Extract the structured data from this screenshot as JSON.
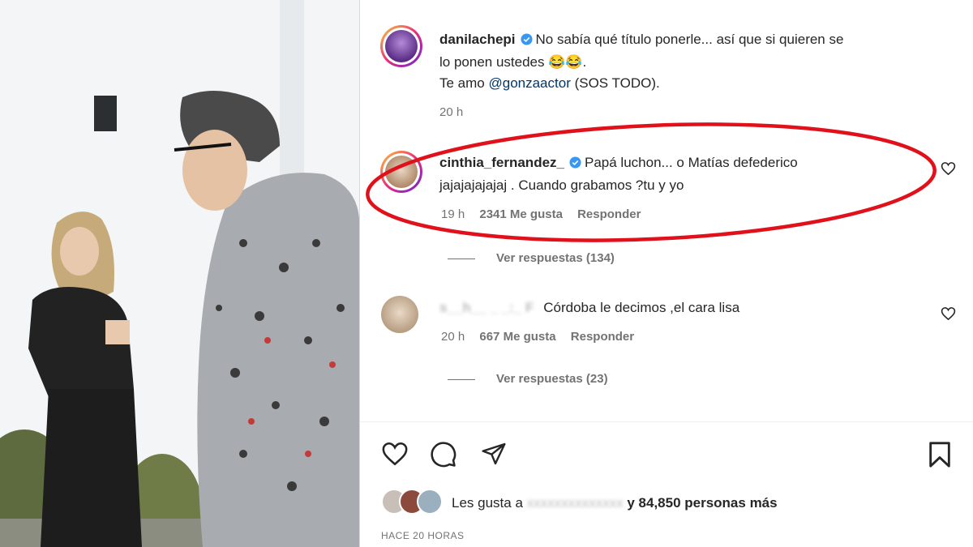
{
  "post": {
    "author": "danilachepi",
    "caption_line1": "No sabía qué título ponerle... así que si quieren se",
    "caption_line2": "lo ponen ustedes 😂😂.",
    "caption_line3_prefix": "Te amo ",
    "caption_mention": "@gonzaactor",
    "caption_line3_suffix": " (SOS TODO).",
    "time": "20 h"
  },
  "comments": [
    {
      "author": "cinthia_fernandez_",
      "text_line1": "Papá luchon... o Matías defederico",
      "text_line2": "jajajajajajaj . Cuando grabamos ?tu y yo",
      "time": "19 h",
      "likes": "2341 Me gusta",
      "reply": "Responder",
      "view_replies": "Ver respuestas (134)"
    },
    {
      "author": "s__h__ _ _:_ F",
      "text": "Córdoba le decimos ,el cara lisa",
      "time": "20 h",
      "likes": "667 Me gusta",
      "reply": "Responder",
      "view_replies": "Ver respuestas (23)"
    }
  ],
  "footer": {
    "likes_prefix": "Les gusta a ",
    "likes_user": "xxxxxxxxxxxxxx",
    "likes_suffix": "y 84,850 personas más",
    "time_ago": "HACE 20 HORAS"
  },
  "icons": {
    "like": "heart-icon",
    "comment": "comment-icon",
    "share": "share-icon",
    "save": "bookmark-icon",
    "verified": "verified-badge-icon"
  },
  "colors": {
    "verified": "#3897f0",
    "highlight": "#e0111b",
    "mention": "#00376b"
  }
}
